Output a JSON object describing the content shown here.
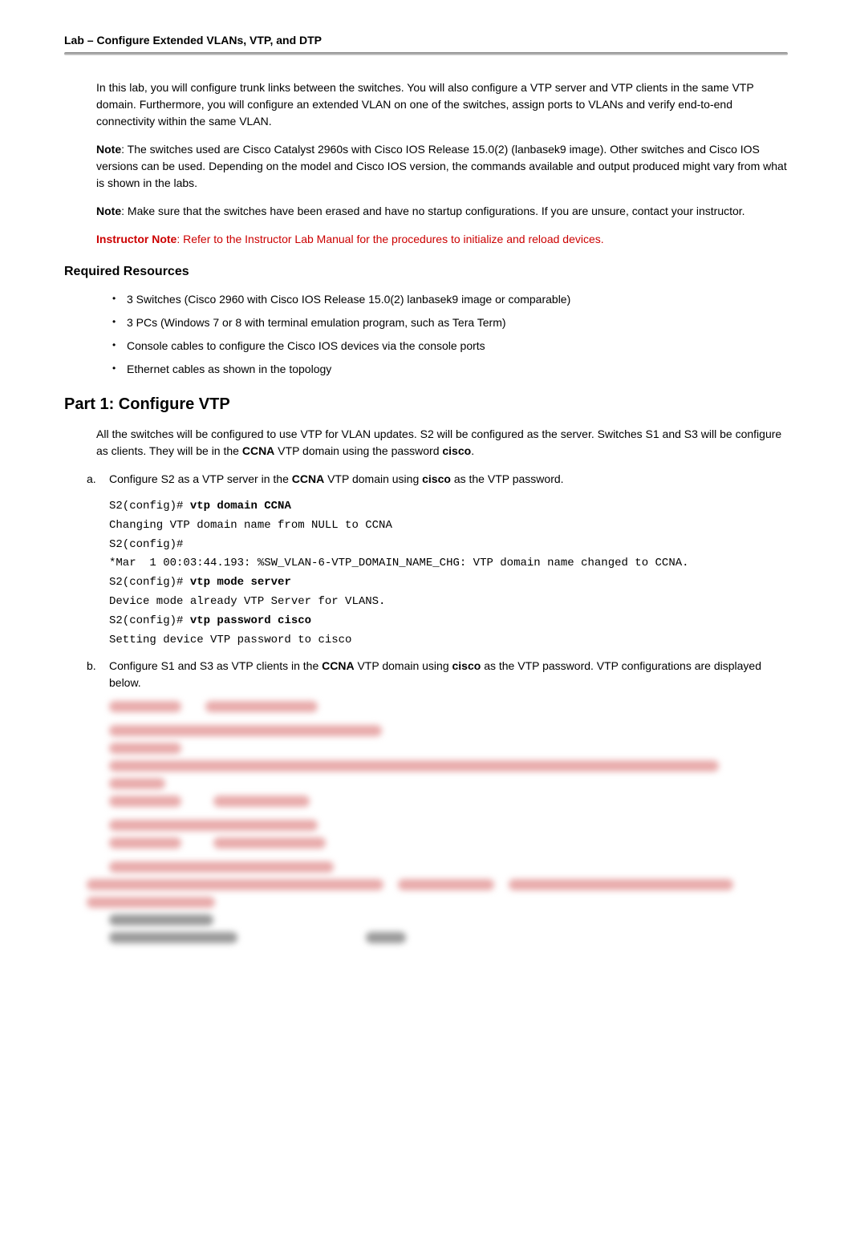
{
  "header": {
    "title": "Lab – Configure Extended VLANs, VTP, and DTP"
  },
  "intro": {
    "p1": "In this lab, you will configure trunk links between the switches. You will also configure a VTP server and VTP clients in the same VTP domain. Furthermore, you will configure an extended VLAN on one of the switches, assign ports to VLANs and verify end-to-end connectivity within the same VLAN.",
    "note1_label": "Note",
    "note1_text": ": The switches used are Cisco Catalyst 2960s with Cisco IOS Release 15.0(2) (lanbasek9 image). Other switches and Cisco IOS versions can be used. Depending on the model and Cisco IOS version, the commands available and output produced might vary from what is shown in the labs.",
    "note2_label": "Note",
    "note2_text": ": Make sure that the switches have been erased and have no startup configurations. If you are unsure, contact your instructor.",
    "instructor_label": "Instructor Note",
    "instructor_text": ": Refer to the Instructor Lab Manual for the procedures to initialize and reload devices."
  },
  "required": {
    "heading": "Required Resources",
    "items": [
      "3 Switches (Cisco 2960 with Cisco IOS Release 15.0(2) lanbasek9 image or comparable)",
      "3 PCs (Windows 7 or 8 with terminal emulation program, such as Tera Term)",
      "Console cables to configure the Cisco IOS devices via the console ports",
      "Ethernet cables as shown in the topology"
    ]
  },
  "part1": {
    "heading": "Part 1: Configure VTP",
    "intro_pre": "All the switches will be configured to use VTP for VLAN updates. S2 will be configured as the server. Switches S1 and S3 will be configure as clients. They will be in the ",
    "intro_bold1": "CCNA",
    "intro_mid": " VTP domain using the password ",
    "intro_bold2": "cisco",
    "intro_end": ".",
    "step_a": {
      "letter": "a.",
      "text_pre": "Configure S2 as a VTP server in the ",
      "text_b1": "CCNA",
      "text_mid": " VTP domain using ",
      "text_b2": "cisco",
      "text_end": " as the VTP password.",
      "code": {
        "l1a": "S2(config)# ",
        "l1b": "vtp domain CCNA",
        "l2": "Changing VTP domain name from NULL to CCNA",
        "l3": "S2(config)#",
        "l4": "*Mar  1 00:03:44.193: %SW_VLAN-6-VTP_DOMAIN_NAME_CHG: VTP domain name changed to CCNA.",
        "l5a": "S2(config)# ",
        "l5b": "vtp mode server",
        "l6": "Device mode already VTP Server for VLANS.",
        "l7a": "S2(config)# ",
        "l7b": "vtp password cisco",
        "l8": "Setting device VTP password to cisco"
      }
    },
    "step_b": {
      "letter": "b.",
      "text_pre": "Configure S1 and S3 as VTP clients in the ",
      "text_b1": "CCNA",
      "text_mid": " VTP domain using ",
      "text_b2": "cisco",
      "text_end": " as the VTP password. VTP configurations are displayed below."
    }
  }
}
